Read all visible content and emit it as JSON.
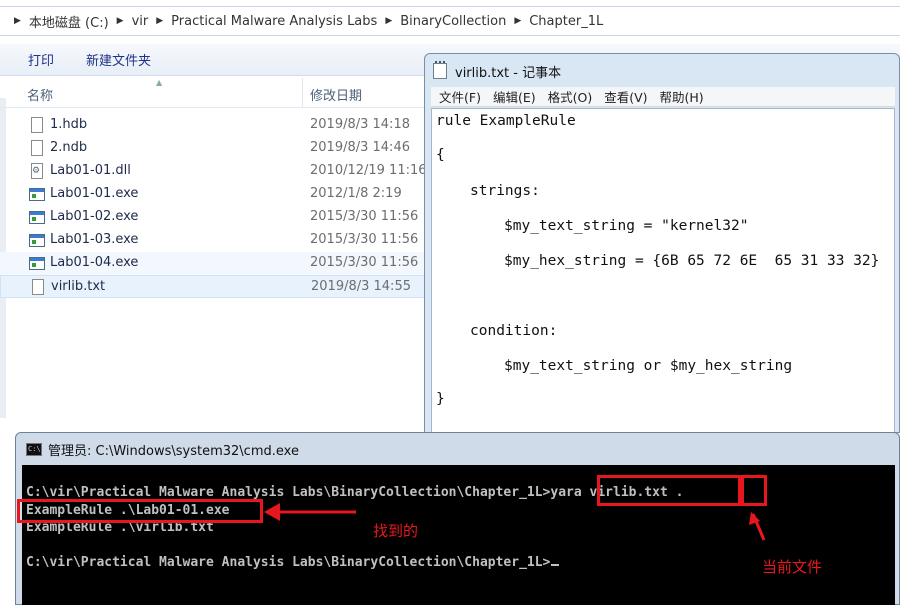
{
  "address_bar": {
    "crumbs": [
      "本地磁盘 (C:)",
      "vir",
      "Practical Malware Analysis Labs",
      "BinaryCollection",
      "Chapter_1L"
    ]
  },
  "toolbar": {
    "print_label": "打印",
    "new_folder_label": "新建文件夹"
  },
  "columns": {
    "name": "名称",
    "modified": "修改日期"
  },
  "files": [
    {
      "name": "1.hdb",
      "date": "2019/8/3 14:18",
      "icon": "document-icon"
    },
    {
      "name": "2.ndb",
      "date": "2019/8/3 14:46",
      "icon": "document-icon"
    },
    {
      "name": "Lab01-01.dll",
      "date": "2010/12/19 11:16",
      "icon": "dll-icon"
    },
    {
      "name": "Lab01-01.exe",
      "date": "2012/1/8 2:19",
      "icon": "exe-icon"
    },
    {
      "name": "Lab01-02.exe",
      "date": "2015/3/30 11:56",
      "icon": "exe-icon"
    },
    {
      "name": "Lab01-03.exe",
      "date": "2015/3/30 11:56",
      "icon": "exe-icon"
    },
    {
      "name": "Lab01-04.exe",
      "date": "2015/3/30 11:56",
      "icon": "exe-icon"
    },
    {
      "name": "virlib.txt",
      "date": "2019/8/3 14:55",
      "icon": "document-icon"
    }
  ],
  "notepad": {
    "title": "virlib.txt - 记事本",
    "menu": [
      "文件(F)",
      "编辑(E)",
      "格式(O)",
      "查看(V)",
      "帮助(H)"
    ],
    "lines": [
      "rule ExampleRule",
      "{",
      "strings:",
      "$my_text_string = \"kernel32\"",
      "$my_hex_string = {6B 65 72 6E  65 31 33 32}",
      "condition:",
      "$my_text_string or $my_hex_string",
      "}"
    ]
  },
  "cmd": {
    "title": "管理员: C:\\Windows\\system32\\cmd.exe",
    "prompt": "C:\\vir\\Practical Malware Analysis Labs\\BinaryCollection\\Chapter_1L>",
    "command": "yara virlib.txt",
    "command_arg": ".",
    "output": [
      "ExampleRule .\\Lab01-01.exe",
      "ExampleRule .\\virlib.txt"
    ]
  },
  "annotations": {
    "found_label": "找到的",
    "current_file_label": "当前文件"
  },
  "colors": {
    "annotation_red": "#e8171d",
    "console_bg": "#000000",
    "console_fg": "#c0c0c0"
  }
}
